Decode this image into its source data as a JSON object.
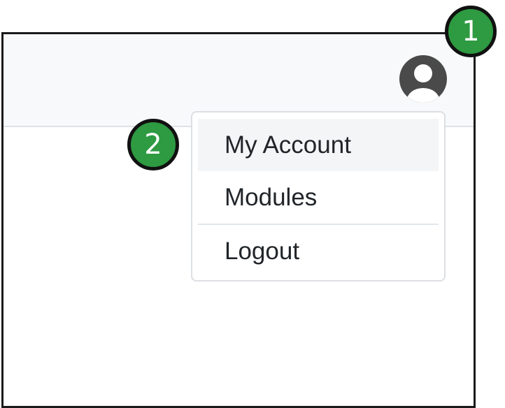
{
  "colors": {
    "topbar_bg": "#f8f9fa",
    "avatar": "#4a4a4a",
    "badge_bg": "#2e9a41",
    "badge_border": "#111111",
    "menu_text": "#212529"
  },
  "header": {
    "avatar_icon": "user-circle-icon"
  },
  "dropdown": {
    "items": [
      {
        "label": "My Account"
      },
      {
        "label": "Modules"
      },
      {
        "label": "Logout"
      }
    ]
  },
  "annotations": [
    {
      "label": "1"
    },
    {
      "label": "2"
    }
  ]
}
